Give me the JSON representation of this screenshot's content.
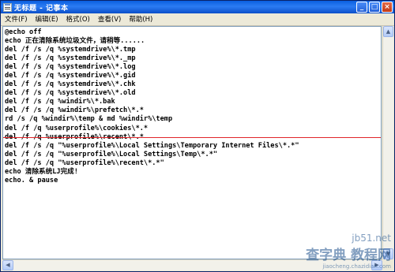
{
  "window": {
    "title": "无标题 - 记事本",
    "minimize": "_",
    "maximize": "□",
    "close": "×"
  },
  "menu": [
    "文件(F)",
    "编辑(E)",
    "格式(O)",
    "查看(V)",
    "帮助(H)"
  ],
  "editor": {
    "text": "@echo off\necho 正在清除系统垃圾文件，请稍等......\ndel /f /s /q %systemdrive%\\*.tmp\ndel /f /s /q %systemdrive%\\*._mp\ndel /f /s /q %systemdrive%\\*.log\ndel /f /s /q %systemdrive%\\*.gid\ndel /f /s /q %systemdrive%\\*.chk\ndel /f /s /q %systemdrive%\\*.old\ndel /f /s /q %windir%\\*.bak\ndel /f /s /q %windir%\\prefetch\\*.*\nrd /s /q %windir%\\temp & md %windir%\\temp\ndel /f /q %userprofile%\\cookies\\*.*\ndel /f /q %userprofile%\\recent\\*.*\ndel /f /s /q \"%userprofile%\\Local Settings\\Temporary Internet Files\\*.*\"\ndel /f /s /q \"%userprofile%\\Local Settings\\Temp\\*.*\"\ndel /f /s /q \"%userprofile%\\recent\\*.*\"\necho 清除系统LJ完成!\necho. & pause"
  },
  "scrollbar": {
    "up": "▲",
    "down": "▼",
    "left": "◀",
    "right": "▶"
  },
  "watermark": {
    "line1": "jb51.net",
    "line2": "查字典 教程网",
    "line3": "jiaocheng.chazidian.com"
  },
  "colors": {
    "title_bar": "#0A5FE0",
    "annotation_line": "#E0262A",
    "chrome": "#ECE9D8"
  }
}
